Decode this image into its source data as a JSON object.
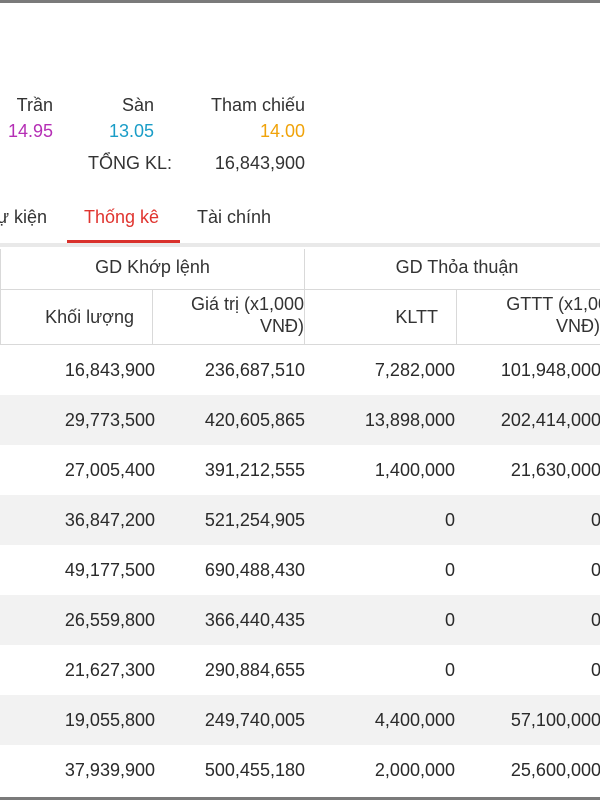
{
  "prices": {
    "ceiling_label": "Trần",
    "ceiling_value": "14.95",
    "floor_label": "Sàn",
    "floor_value": "13.05",
    "reference_label": "Tham chiếu",
    "reference_value": "14.00",
    "total_volume_label": "TỔNG KL:",
    "total_volume_value": "16,843,900",
    "colors": {
      "ceiling": "#b52fb5",
      "floor": "#1a9dc7",
      "reference": "#f0a30a"
    }
  },
  "tabs": [
    {
      "label": "ự kiện",
      "active": false
    },
    {
      "label": "Thống kê",
      "active": true
    },
    {
      "label": "Tài chính",
      "active": false
    }
  ],
  "table": {
    "group_headers": [
      "GD Khớp lệnh",
      "GD Thỏa thuận"
    ],
    "columns": [
      {
        "label": "Khối lượng"
      },
      {
        "label_line1": "Giá trị (x1,000",
        "label_line2": "VNĐ)"
      },
      {
        "label": "KLTT"
      },
      {
        "label_line1": "GTTT (x1,000",
        "label_line2": "VNĐ)"
      }
    ],
    "rows": [
      [
        "16,843,900",
        "236,687,510",
        "7,282,000",
        "101,948,000"
      ],
      [
        "29,773,500",
        "420,605,865",
        "13,898,000",
        "202,414,000"
      ],
      [
        "27,005,400",
        "391,212,555",
        "1,400,000",
        "21,630,000"
      ],
      [
        "36,847,200",
        "521,254,905",
        "0",
        "0"
      ],
      [
        "49,177,500",
        "690,488,430",
        "0",
        "0"
      ],
      [
        "26,559,800",
        "366,440,435",
        "0",
        "0"
      ],
      [
        "21,627,300",
        "290,884,655",
        "0",
        "0"
      ],
      [
        "19,055,800",
        "249,740,005",
        "4,400,000",
        "57,100,000"
      ],
      [
        "37,939,900",
        "500,455,180",
        "2,000,000",
        "25,600,000"
      ]
    ]
  },
  "accent_color": "#e0342f"
}
